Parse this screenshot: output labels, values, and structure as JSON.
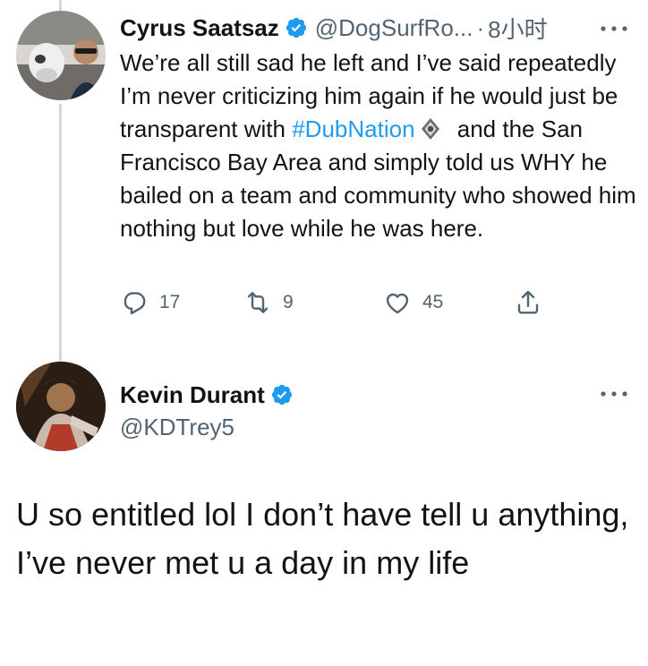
{
  "colors": {
    "link": "#1d9bf0",
    "secondary": "#536471",
    "verified": "#1d9bf0",
    "text": "#0f1419"
  },
  "tweet_reply": {
    "author": {
      "display_name": "Cyrus Saatsaz",
      "handle": "@DogSurfRo...",
      "time": "8小时",
      "verified": true,
      "avatar_icon": "avatar-photo"
    },
    "text_parts": {
      "line_start": "We’re all still sad he left and I’ve said repeatedly I’m never criticizing him again if he would just be transparent with ",
      "hashtag": "#DubNation",
      "line_end": " and the San Francisco Bay Area and simply told us WHY he bailed on a team and community who showed him nothing but love while he was here."
    },
    "actions": {
      "reply_count": "17",
      "retweet_count": "9",
      "like_count": "45"
    }
  },
  "tweet_main": {
    "author": {
      "display_name": "Kevin Durant",
      "handle": "@KDTrey5",
      "verified": true,
      "avatar_icon": "avatar-photo"
    },
    "text": "U so entitled lol I don’t have tell u anything, I’ve never met u a day in my life"
  }
}
